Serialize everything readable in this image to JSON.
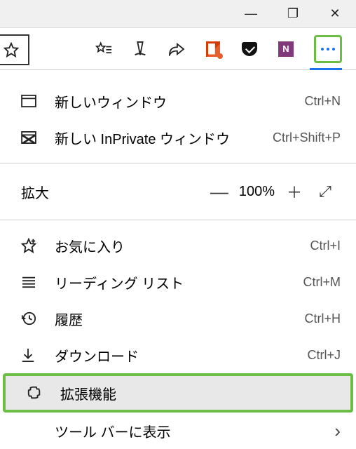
{
  "window_controls": {
    "min_glyph": "—",
    "max_glyph": "❐",
    "close_glyph": "✕"
  },
  "toolbar": {
    "star_glyph": "☆",
    "starline_glyph": "✩≡",
    "pen_glyph": "✎",
    "share_glyph": "↗",
    "more_glyph": "⋯"
  },
  "menu": {
    "new_window": {
      "label": "新しいウィンドウ",
      "shortcut": "Ctrl+N"
    },
    "new_inprivate": {
      "label": "新しい InPrivate ウィンドウ",
      "shortcut": "Ctrl+Shift+P"
    },
    "zoom": {
      "label": "拡大",
      "minus": "—",
      "value": "100%",
      "plus": "＋",
      "full": "⤢"
    },
    "favorites": {
      "label": "お気に入り",
      "shortcut": "Ctrl+I"
    },
    "reading_list": {
      "label": "リーディング リスト",
      "shortcut": "Ctrl+M"
    },
    "history": {
      "label": "履歴",
      "shortcut": "Ctrl+H"
    },
    "downloads": {
      "label": "ダウンロード",
      "shortcut": "Ctrl+J"
    },
    "extensions": {
      "label": "拡張機能"
    },
    "show_in_toolbar": {
      "label": "ツール バーに表示",
      "arrow": "›"
    }
  }
}
